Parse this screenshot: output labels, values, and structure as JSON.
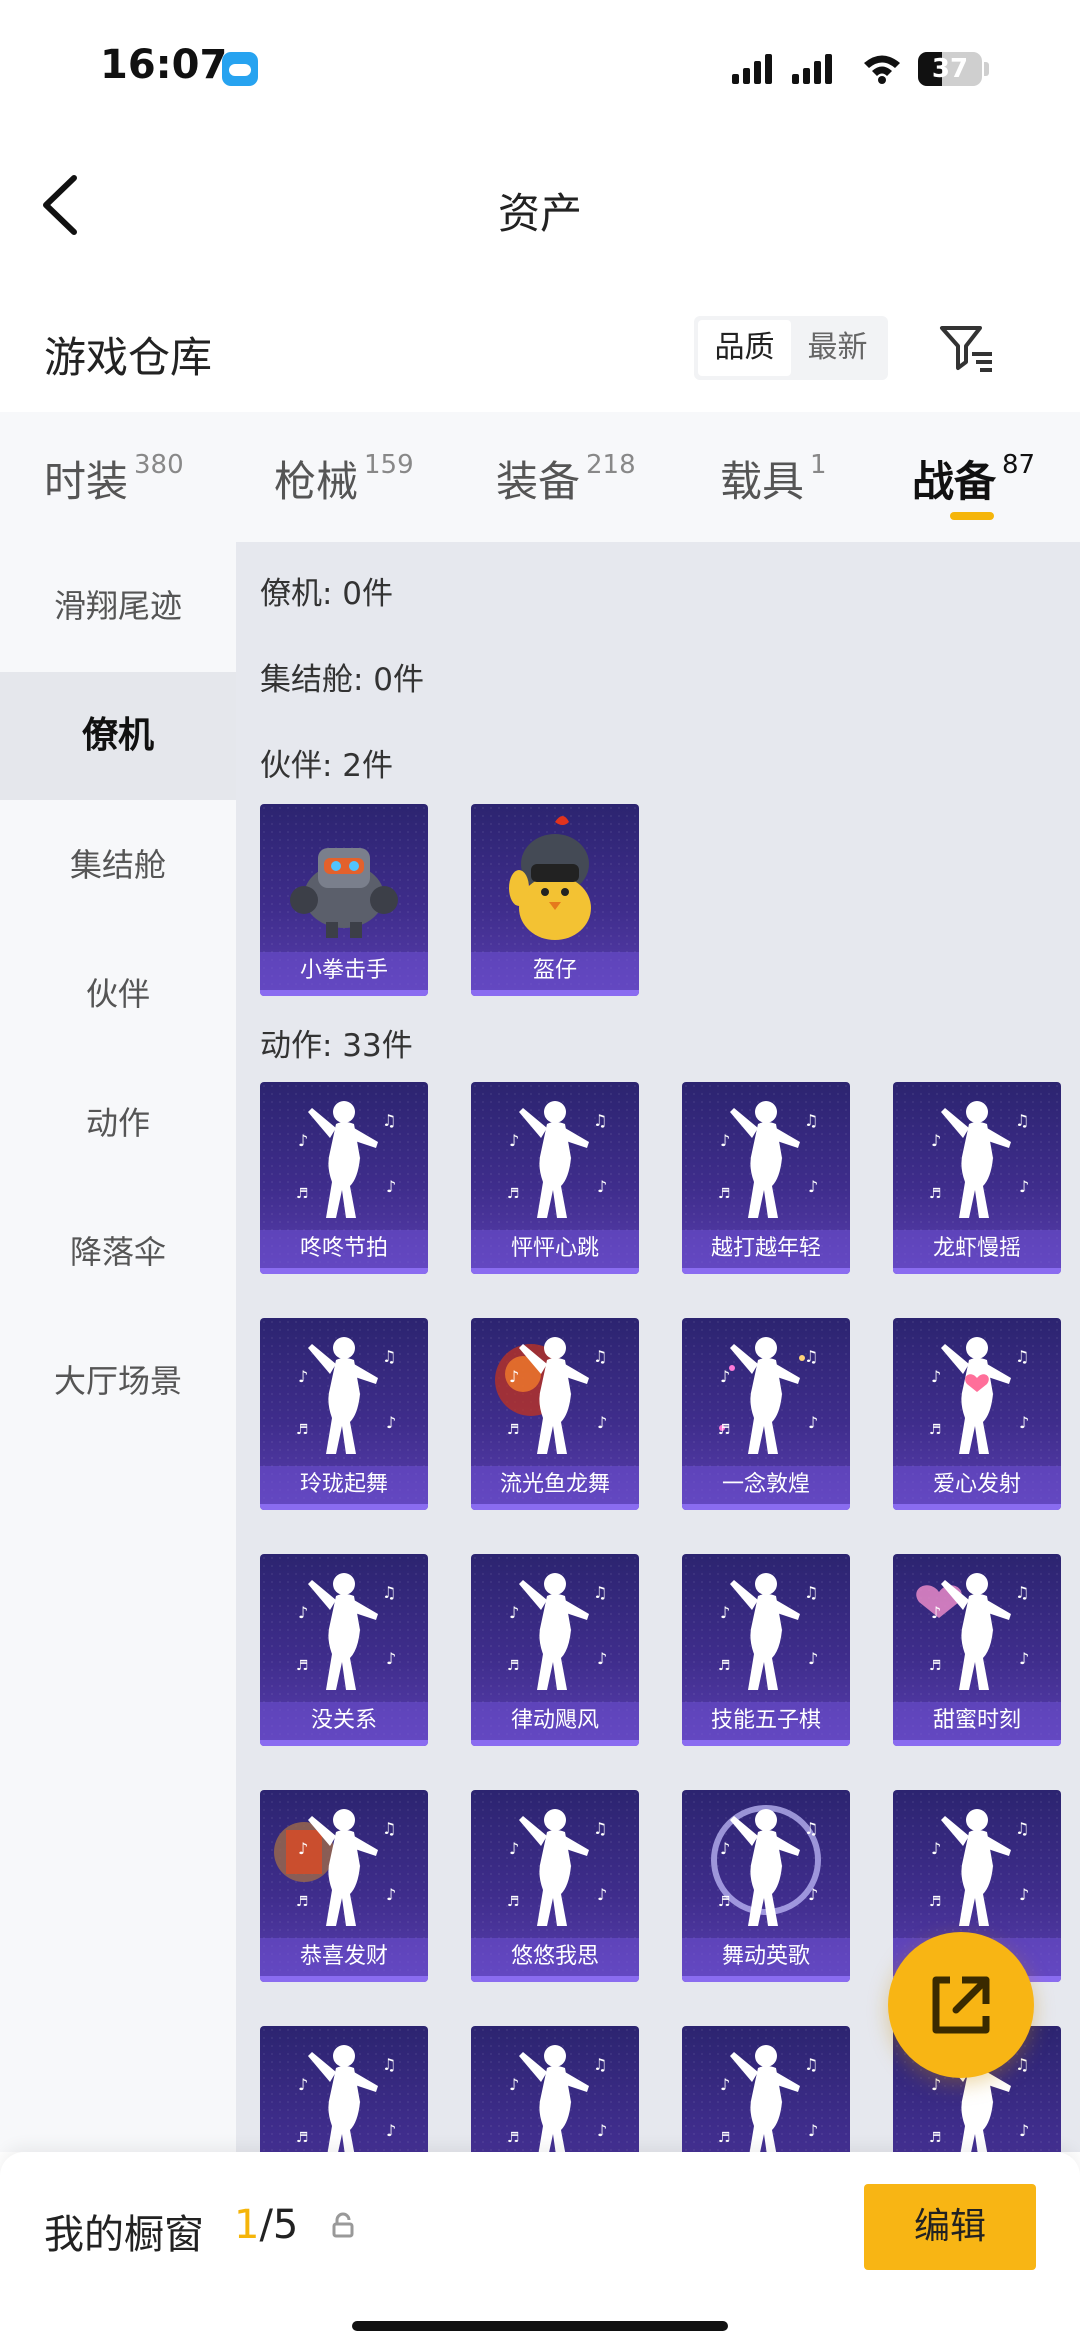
{
  "status_bar": {
    "time": "16:07",
    "battery": "37",
    "battery_level": 0.37
  },
  "nav": {
    "title": "资产"
  },
  "header": {
    "title": "游戏仓库",
    "sort_options": [
      "品质",
      "最新"
    ]
  },
  "category_tabs": [
    {
      "label": "时装",
      "count": "380"
    },
    {
      "label": "枪械",
      "count": "159"
    },
    {
      "label": "装备",
      "count": "218"
    },
    {
      "label": "载具",
      "count": "1"
    },
    {
      "label": "战备",
      "count": "87",
      "active": true
    }
  ],
  "sidebar": {
    "items": [
      "滑翔尾迹",
      "僚机",
      "集结舱",
      "伙伴",
      "动作",
      "降落伞",
      "大厅场景"
    ],
    "active": "僚机"
  },
  "sections": {
    "wingman": "僚机: 0件",
    "assembly_pod": "集结舱: 0件",
    "partners": "伙伴: 2件",
    "actions": "动作: 33件"
  },
  "partners": [
    "小拳击手",
    "盔仔"
  ],
  "actions": [
    "咚咚节拍",
    "怦怦心跳",
    "越打越年轻",
    "龙虾慢摇",
    "玲珑起舞",
    "流光鱼龙舞",
    "一念敦煌",
    "爱心发射",
    "没关系",
    "律动飓风",
    "技能五子棋",
    "甜蜜时刻",
    "恭喜发财",
    "悠悠我思",
    "舞动英歌",
    ""
  ],
  "bottom_bar": {
    "label": "我的橱窗",
    "current": "1",
    "total": "/5",
    "edit_label": "编辑"
  },
  "colors": {
    "accent": "#f5b50a",
    "card_top": "#2c2470",
    "card_bottom": "#5a3fb0"
  }
}
